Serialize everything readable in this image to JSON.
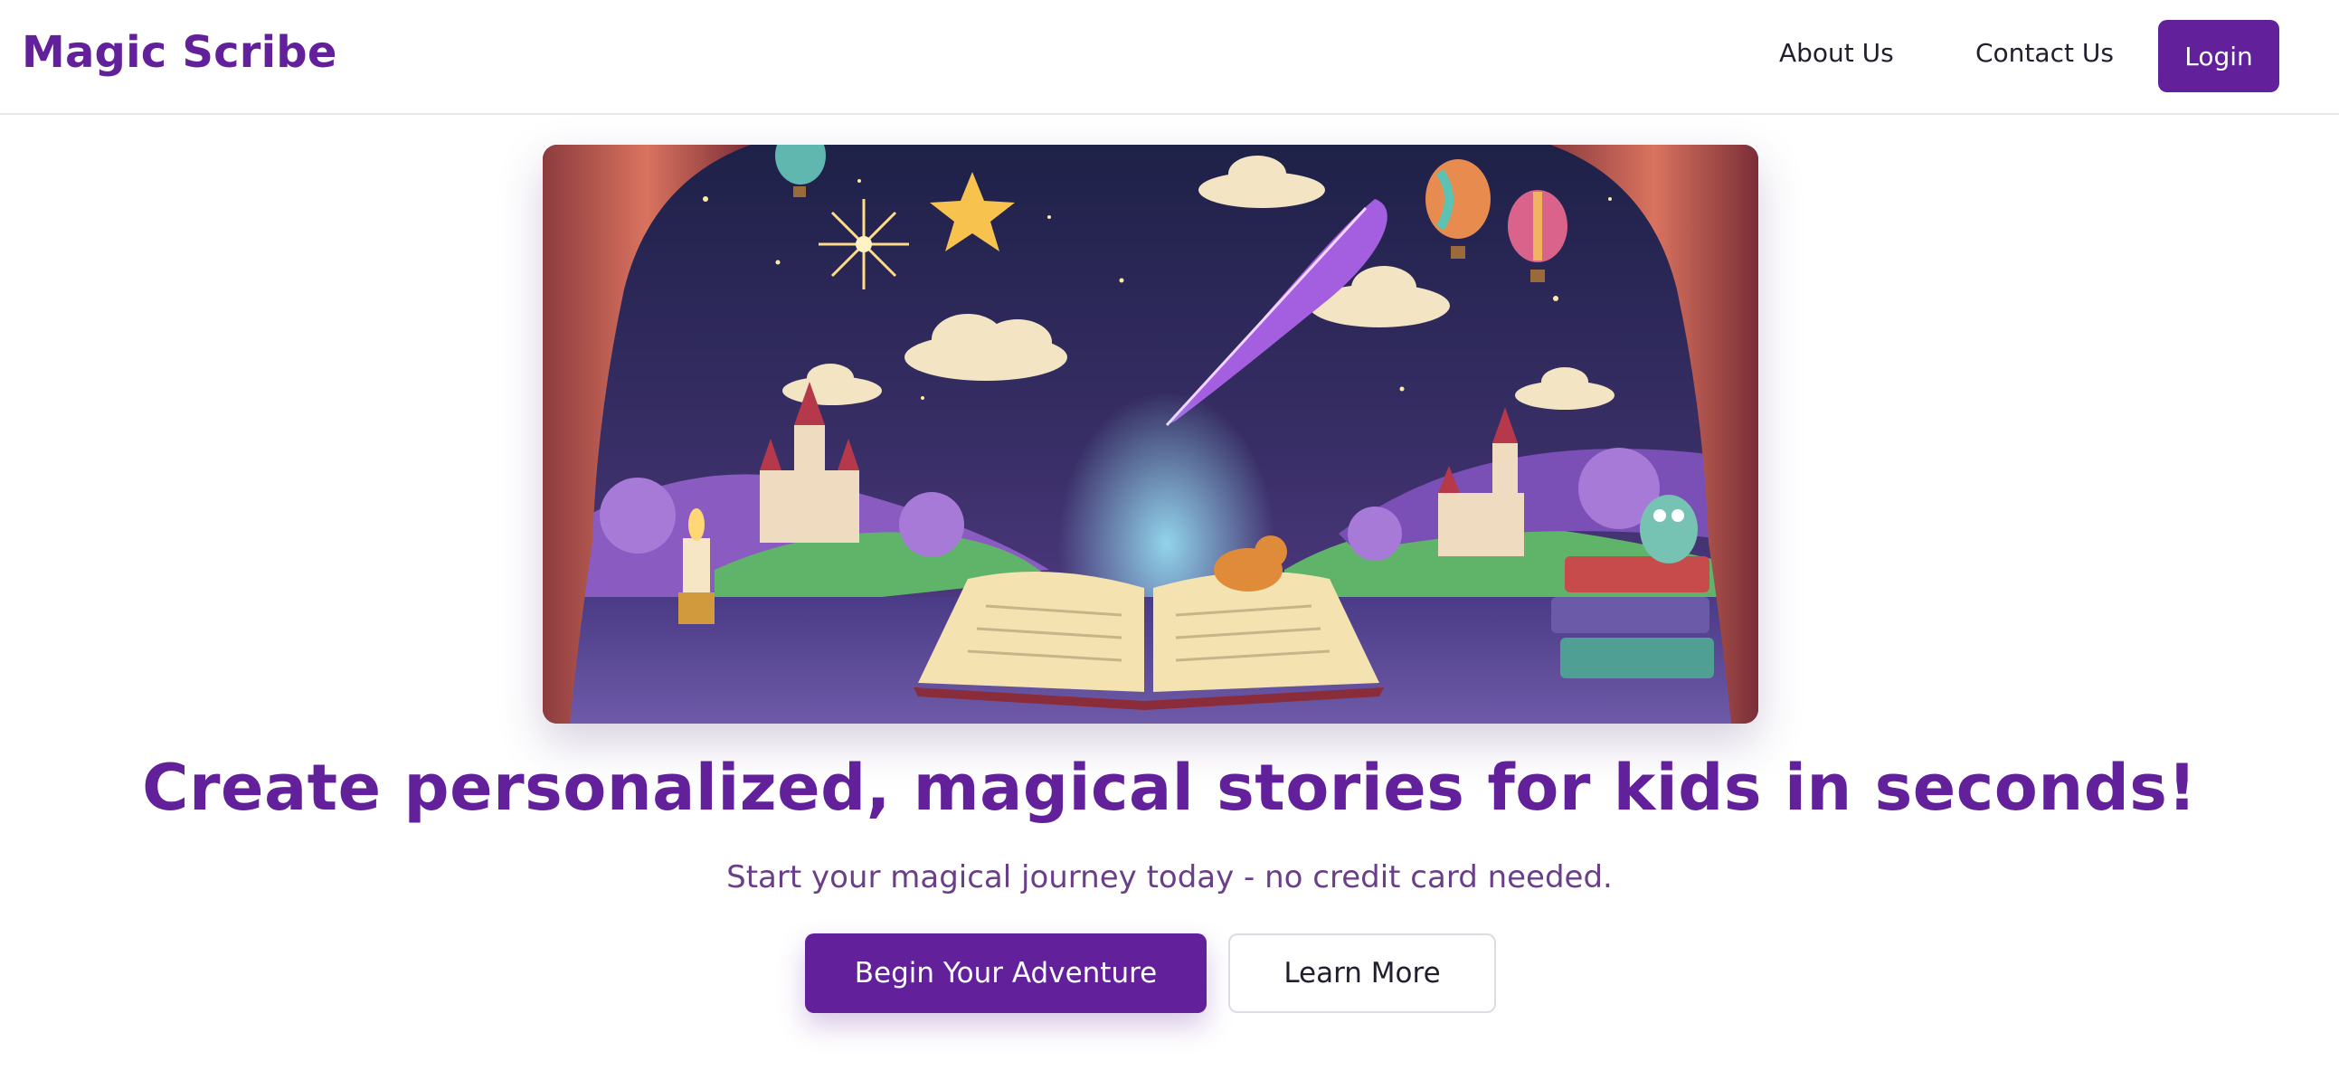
{
  "header": {
    "brand": "Magic Scribe",
    "nav": [
      "About Us",
      "Contact Us"
    ],
    "login_label": "Login"
  },
  "hero": {
    "headline": "Create personalized, magical stories for kids in seconds!",
    "subhead": "Start your magical journey today - no credit card needed.",
    "primary_cta": "Begin Your Adventure",
    "secondary_cta": "Learn More"
  },
  "colors": {
    "brand_purple": "#62209a",
    "subtext_purple": "#6a3f88",
    "border_gray": "#dcdce4"
  }
}
